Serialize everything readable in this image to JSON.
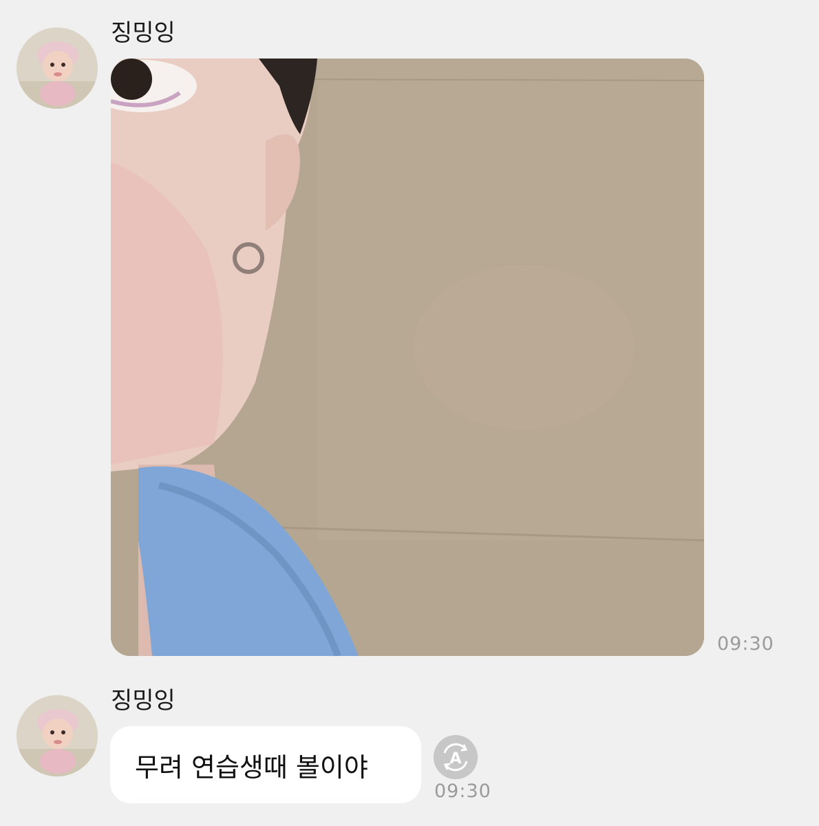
{
  "messages": [
    {
      "sender": "징밍잉",
      "type": "photo",
      "time": "09:30"
    },
    {
      "sender": "징밍잉",
      "type": "text",
      "text": "무려 연습생때 볼이야",
      "time": "09:30"
    }
  ],
  "icons": {
    "avatar": "avatar-icon",
    "translate": "translate-icon"
  },
  "colors": {
    "background": "#f0f0f0",
    "bubble": "#ffffff",
    "timestamp": "#9a9a9a"
  }
}
